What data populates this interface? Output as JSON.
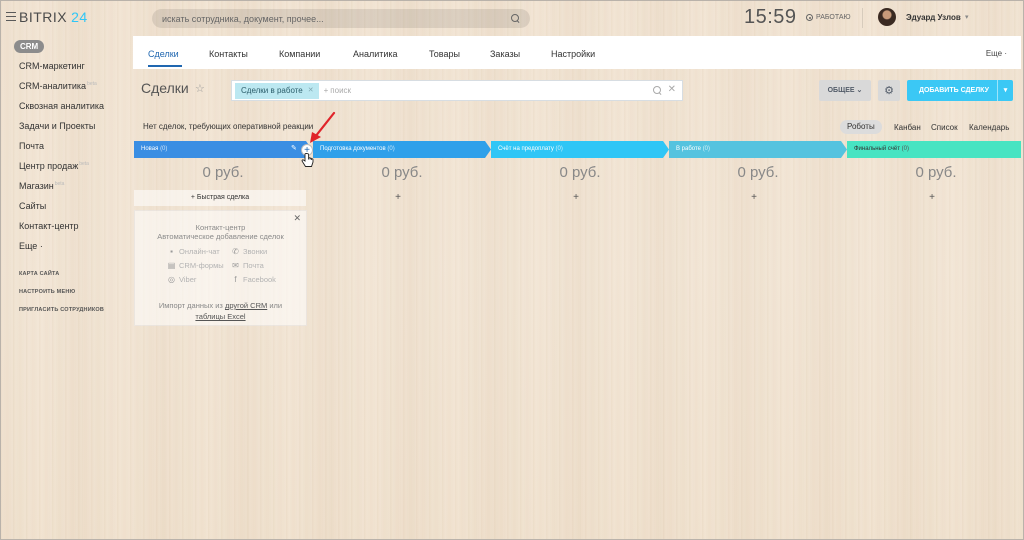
{
  "app": {
    "brand": "BITRIX",
    "brand_num": "24"
  },
  "search": {
    "placeholder": "искать сотрудника, документ, прочее..."
  },
  "clock": "15:59",
  "status": "РАБОТАЮ",
  "user": {
    "name": "Эдуард Узлов"
  },
  "sidebar": {
    "active": "CRM",
    "items": [
      {
        "label": "CRM-маркетинг",
        "sup": ""
      },
      {
        "label": "CRM-аналитика",
        "sup": "beta"
      },
      {
        "label": "Сквозная аналитика",
        "sup": ""
      },
      {
        "label": "Задачи и Проекты",
        "sup": ""
      },
      {
        "label": "Почта",
        "sup": ""
      },
      {
        "label": "Центр продаж",
        "sup": "beta"
      },
      {
        "label": "Магазин",
        "sup": "beta"
      },
      {
        "label": "Сайты",
        "sup": ""
      },
      {
        "label": "Контакт-центр",
        "sup": ""
      },
      {
        "label": "Еще ·",
        "sup": ""
      }
    ],
    "small": [
      "КАРТА САЙТА",
      "НАСТРОИТЬ МЕНЮ",
      "ПРИГЛАСИТЬ СОТРУДНИКОВ"
    ]
  },
  "tabs": {
    "items": [
      "Сделки",
      "Контакты",
      "Компании",
      "Аналитика",
      "Товары",
      "Заказы",
      "Настройки"
    ],
    "more": "Еще ·"
  },
  "page": {
    "title": "Сделки"
  },
  "filter": {
    "chip": "Сделки в работе",
    "plus": "+",
    "placeholder": "поиск"
  },
  "buttons": {
    "general": "ОБЩЕЕ",
    "add": "ДОБАВИТЬ СДЕЛКУ"
  },
  "notice": "Нет сделок, требующих оперативной реакции",
  "views": {
    "active": "Роботы",
    "items": [
      "Канбан",
      "Список",
      "Календарь"
    ]
  },
  "stages": [
    {
      "name": "Новая",
      "count": "(0)",
      "sum": "0 руб.",
      "color": "#3a8ee3"
    },
    {
      "name": "Подготовка документов",
      "count": "(0)",
      "sum": "0 руб.",
      "color": "#2fa0ea"
    },
    {
      "name": "Счёт на предоплату",
      "count": "(0)",
      "sum": "0 руб.",
      "color": "#2fc6f6"
    },
    {
      "name": "В работе",
      "count": "(0)",
      "sum": "0 руб.",
      "color": "#55c3df"
    },
    {
      "name": "Финальный счёт",
      "count": "(0)",
      "sum": "0 руб.",
      "color": "#47e4c2"
    }
  ],
  "quick_deal": "Быстрая сделка",
  "contact_center": {
    "title": "Контакт-центр",
    "subtitle": "Автоматическое добавление сделок",
    "links": [
      {
        "label": "Онлайн-чат",
        "icon": "chat-icon"
      },
      {
        "label": "Звонки",
        "icon": "phone-icon"
      },
      {
        "label": "CRM-формы",
        "icon": "form-icon"
      },
      {
        "label": "Почта",
        "icon": "mail-icon"
      },
      {
        "label": "Viber",
        "icon": "viber-icon"
      },
      {
        "label": "Facebook",
        "icon": "facebook-icon"
      }
    ],
    "import_pre": "Импорт данных из",
    "import_link1": "другой CRM",
    "import_mid": "или",
    "import_link2": "таблицы Excel"
  }
}
